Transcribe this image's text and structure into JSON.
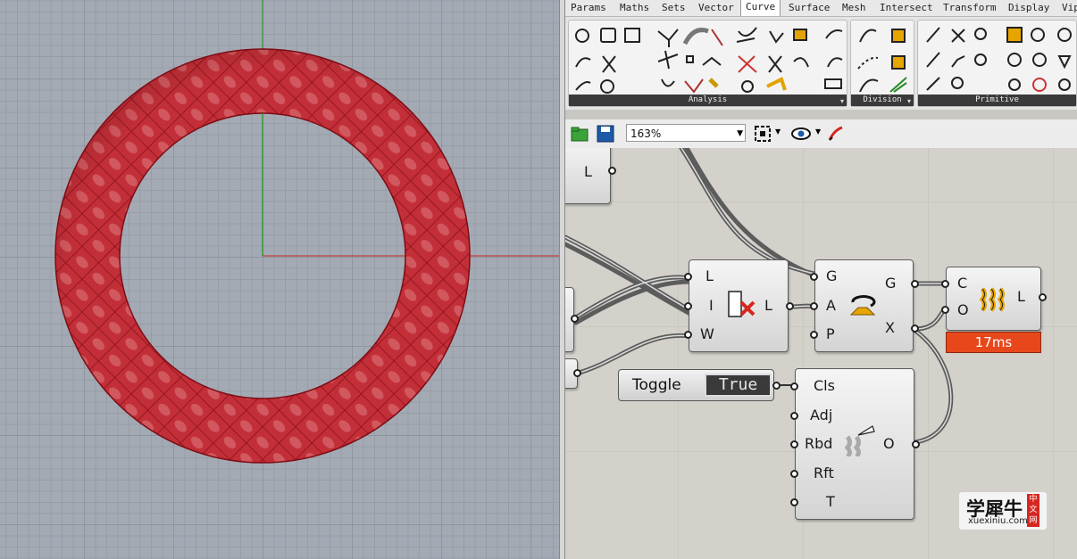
{
  "tabs": [
    {
      "label": "Params",
      "active": false
    },
    {
      "label": "Maths",
      "active": false
    },
    {
      "label": "Sets",
      "active": false
    },
    {
      "label": "Vector",
      "active": false
    },
    {
      "label": "Curve",
      "active": true
    },
    {
      "label": "Surface",
      "active": false
    },
    {
      "label": "Mesh",
      "active": false
    },
    {
      "label": "Intersect",
      "active": false
    },
    {
      "label": "Transform",
      "active": false
    },
    {
      "label": "Display",
      "active": false
    },
    {
      "label": "Vip",
      "active": false
    }
  ],
  "ribbon": {
    "panels": [
      {
        "label": "Analysis"
      },
      {
        "label": "Division"
      },
      {
        "label": "Primitive"
      }
    ]
  },
  "toolbar": {
    "zoom": "163%"
  },
  "canvas": {
    "stub_top_label": "L",
    "cull": {
      "inputs": [
        "L",
        "I",
        "W"
      ],
      "outputs": [
        "L"
      ]
    },
    "rotate": {
      "inputs": [
        "G",
        "A",
        "P"
      ],
      "outputs": [
        "G",
        "X"
      ]
    },
    "loft_main": {
      "inputs": [
        "C",
        "O"
      ],
      "outputs": [
        "L"
      ],
      "timer": "17ms"
    },
    "toggle": {
      "label": "Toggle",
      "value": "True"
    },
    "loft_opts": {
      "inputs": [
        "Cls",
        "Adj",
        "Rbd",
        "Rft",
        "T"
      ],
      "outputs": [
        "O"
      ]
    }
  },
  "watermark": {
    "title": "学犀牛",
    "url": "xuexiniu.com",
    "badge": "中文网"
  },
  "colors": {
    "torus": "#c9303a",
    "timer": "#e8471c",
    "axis_x": "#c04040",
    "axis_y": "#2f9a2f"
  }
}
